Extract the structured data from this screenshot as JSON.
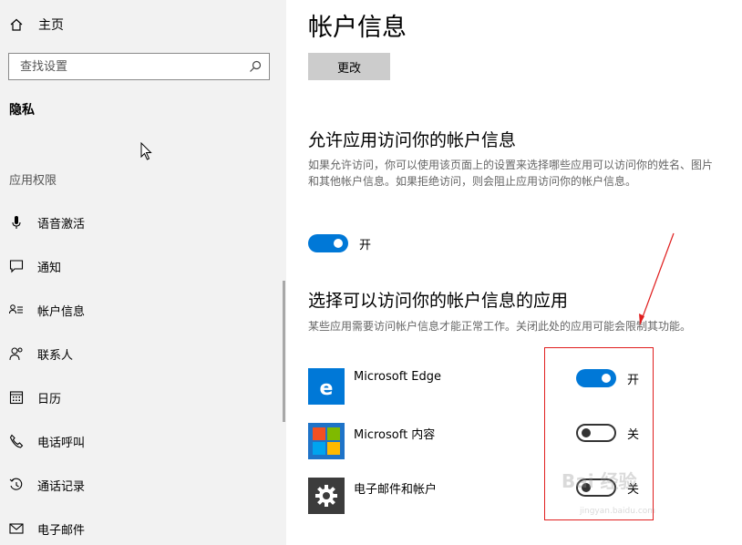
{
  "sidebar": {
    "home_label": "主页",
    "search_placeholder": "查找设置",
    "section_title": "隐私",
    "group_label": "应用权限",
    "items": [
      {
        "label": "语音激活",
        "icon": "microphone-icon"
      },
      {
        "label": "通知",
        "icon": "notification-icon"
      },
      {
        "label": "帐户信息",
        "icon": "account-info-icon"
      },
      {
        "label": "联系人",
        "icon": "contacts-icon"
      },
      {
        "label": "日历",
        "icon": "calendar-icon"
      },
      {
        "label": "电话呼叫",
        "icon": "phone-icon"
      },
      {
        "label": "通话记录",
        "icon": "call-history-icon"
      },
      {
        "label": "电子邮件",
        "icon": "email-icon"
      }
    ]
  },
  "main": {
    "title": "帐户信息",
    "change_button": "更改",
    "allow_section": {
      "heading": "允许应用访问你的帐户信息",
      "description": "如果允许访问，你可以使用该页面上的设置来选择哪些应用可以访问你的姓名、图片和其他帐户信息。如果拒绝访问，则会阻止应用访问你的帐户信息。",
      "toggle_state": "on",
      "toggle_label": "开"
    },
    "choose_section": {
      "heading": "选择可以访问你的帐户信息的应用",
      "description": "某些应用需要访问帐户信息才能正常工作。关闭此处的应用可能会限制其功能。"
    },
    "apps": [
      {
        "name": "Microsoft Edge",
        "icon": "edge-icon",
        "state": "on",
        "state_label": "开",
        "icon_color": "#0078d7"
      },
      {
        "name": "Microsoft 内容",
        "icon": "microsoft-content-icon",
        "state": "off",
        "state_label": "关",
        "icon_color": "#1e73c8"
      },
      {
        "name": "电子邮件和帐户",
        "icon": "gear-icon",
        "state": "off",
        "state_label": "关",
        "icon_color": "#3c3c3c"
      }
    ]
  },
  "colors": {
    "accent": "#0078d7",
    "annotation": "#e01e1e",
    "sidebar_bg": "#f2f2f2"
  },
  "watermark": {
    "text": "Bai 经验",
    "sub": "jingyan.baidu.com"
  }
}
